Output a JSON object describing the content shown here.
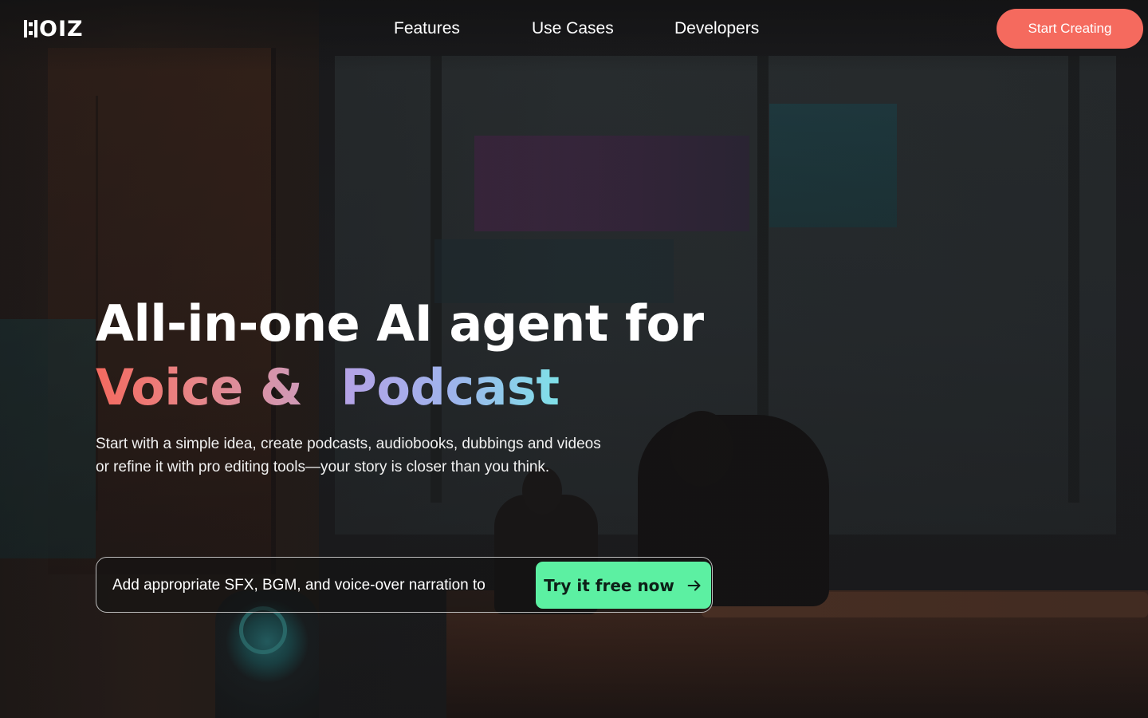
{
  "nav": {
    "logo_text": "OIZ",
    "links": [
      "Features",
      "Use Cases",
      "Developers"
    ],
    "cta_label": "Start Creating"
  },
  "hero": {
    "title_line1": "All-in-one AI agent for",
    "title_highlight_1": "Voice &",
    "title_highlight_2": "Podcast",
    "subtitle_line1": "Start with a simple idea, create podcasts, audiobooks, dubbings and videos",
    "subtitle_line2": "or refine it with pro editing tools—your story is closer than you think."
  },
  "prompt": {
    "value": "Add appropriate SFX, BGM, and voice-over narration to",
    "button_label": "Try it free now",
    "button_icon": "arrow-right-icon"
  },
  "colors": {
    "cta": "#f56a5e",
    "try_button": "#5cf0a2",
    "gradient_voice": [
      "#f46a60",
      "#cf9ab8"
    ],
    "gradient_podcast": [
      "#b5a2e6",
      "#7fe0e8"
    ]
  }
}
